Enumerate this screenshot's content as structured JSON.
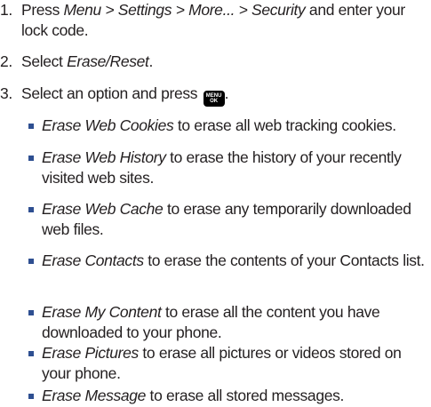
{
  "steps": [
    {
      "number": "1.",
      "prefix": "Press ",
      "path_italic": "Menu > Settings > More... > Security",
      "suffix": " and enter your lock code."
    },
    {
      "number": "2.",
      "prefix": "Select ",
      "option_italic": "Erase/Reset",
      "suffix": "."
    },
    {
      "number": "3.",
      "text": "Select an option and press ",
      "key_top": "MENU",
      "key_bottom": "OK",
      "suffix": "."
    }
  ],
  "options": [
    {
      "name": "Erase Web Cookies",
      "desc": " to erase all web tracking cookies."
    },
    {
      "name": "Erase Web History",
      "desc": " to erase the history of your recently visited web sites."
    },
    {
      "name": "Erase Web Cache",
      "desc": " to erase any temporarily downloaded web files."
    },
    {
      "name": "Erase Contacts",
      "desc": " to erase the contents of your Contacts list."
    },
    {
      "name": "Erase My Content",
      "desc": " to erase all the content you have downloaded to your phone."
    },
    {
      "name": "Erase Pictures",
      "desc": " to erase all pictures or videos stored on your phone."
    },
    {
      "name": "Erase Message",
      "desc": " to erase all stored messages."
    }
  ]
}
